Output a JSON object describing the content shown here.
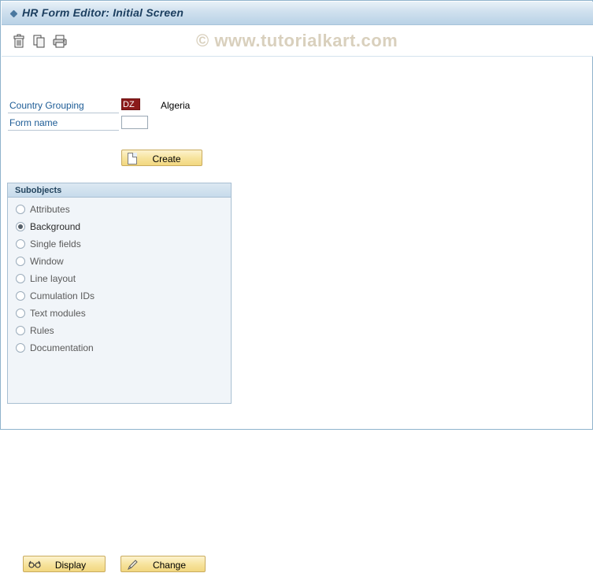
{
  "window": {
    "title": "HR Form Editor: Initial Screen"
  },
  "toolbar": {
    "buttons": [
      {
        "name": "delete-icon",
        "tooltip": "Delete"
      },
      {
        "name": "copy-icon",
        "tooltip": "Copy"
      },
      {
        "name": "print-icon",
        "tooltip": "Print"
      }
    ]
  },
  "watermark": "© www.tutorialkart.com",
  "form": {
    "country_grouping_label": "Country Grouping",
    "country_grouping_value": "DZ",
    "country_grouping_description": "Algeria",
    "form_name_label": "Form name",
    "form_name_value": "",
    "create_button": "Create"
  },
  "subobjects": {
    "title": "Subobjects",
    "options": [
      {
        "label": "Attributes",
        "selected": false,
        "enabled": false
      },
      {
        "label": "Background",
        "selected": true,
        "enabled": true
      },
      {
        "label": "Single fields",
        "selected": false,
        "enabled": false
      },
      {
        "label": "Window",
        "selected": false,
        "enabled": false
      },
      {
        "label": "Line layout",
        "selected": false,
        "enabled": false
      },
      {
        "label": "Cumulation IDs",
        "selected": false,
        "enabled": false
      },
      {
        "label": "Text modules",
        "selected": false,
        "enabled": false
      },
      {
        "label": "Rules",
        "selected": false,
        "enabled": false
      },
      {
        "label": "Documentation",
        "selected": false,
        "enabled": false
      }
    ],
    "display_button": "Display",
    "change_button": "Change"
  },
  "colors": {
    "title_text": "#1c3f60",
    "label_blue": "#1d5c96",
    "input_highlight": "#8b1a1a",
    "button_yellow": "#f7e49f",
    "watermark": "#d9d0bd"
  }
}
